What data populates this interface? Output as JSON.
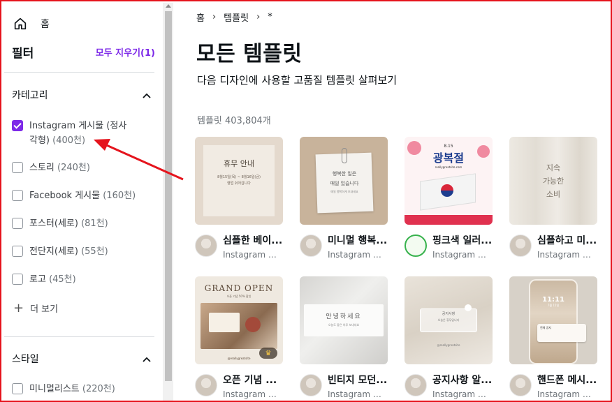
{
  "sidebar": {
    "home_label": "홈",
    "filter_title": "필터",
    "clear_all": "모두 지우기(1)",
    "category_title": "카테고리",
    "style_title": "스타일",
    "more_label": "더 보기",
    "categories": [
      {
        "label": "Instagram 게시물 (정사각형)",
        "count": "(400천)",
        "checked": true
      },
      {
        "label": "스토리",
        "count": "(240천)",
        "checked": false
      },
      {
        "label": "Facebook 게시물",
        "count": "(160천)",
        "checked": false
      },
      {
        "label": "포스터(세로)",
        "count": "(81천)",
        "checked": false
      },
      {
        "label": "전단지(세로)",
        "count": "(55천)",
        "checked": false
      },
      {
        "label": "로고",
        "count": "(45천)",
        "checked": false
      }
    ],
    "styles": [
      {
        "label": "미니멀리스트",
        "count": "(220천)",
        "checked": false
      }
    ]
  },
  "breadcrumb": [
    "홈",
    "템플릿",
    "*"
  ],
  "page_title": "모든 템플릿",
  "subtitle": "다음 디자인에 사용할 고품질 템플릿 살펴보기",
  "template_count": "템플릿 403,804개",
  "colors": {
    "accent": "#7d2ae8",
    "annotation": "#e5141d"
  },
  "templates": [
    {
      "title": "심플한 베이...",
      "type": "Instagram 게...",
      "thumb_text": [
        "휴무 안내",
        "8월15일(목) ~ 8월16일(금)",
        "영업 쉬어갑니다"
      ]
    },
    {
      "title": "미니멀 행복...",
      "type": "Instagram 게...",
      "thumb_text": [
        "행복한 일은",
        "매일 있습니다",
        "매일 행복하게 보내세요"
      ]
    },
    {
      "title": "핑크색 일러...",
      "type": "Instagram 게...",
      "thumb_text": [
        "8.15",
        "광복절",
        "reallygreatsite.com"
      ]
    },
    {
      "title": "심플하고 미...",
      "type": "Instagram 게...",
      "thumb_text": [
        "지속",
        "가능한",
        "소비"
      ]
    },
    {
      "title": "오픈 기념 ...",
      "type": "Instagram 게...",
      "thumb_text": [
        "GRAND OPEN",
        "오픈 기념 50% 할인",
        "@reallygreatsite"
      ]
    },
    {
      "title": "빈티지 모던...",
      "type": "Instagram 게...",
      "thumb_text": [
        "안녕하세요",
        "오늘도 좋은 하루 보내세요"
      ]
    },
    {
      "title": "공지사항 알...",
      "type": "Instagram 게...",
      "thumb_text": [
        "공지사항",
        "오늘은 휴무입니다",
        "@reallygreatsite"
      ]
    },
    {
      "title": "핸드폰 메시...",
      "type": "Instagram 게...",
      "thumb_text": [
        "11:11",
        "7월 15일",
        "전체 공지"
      ]
    }
  ]
}
